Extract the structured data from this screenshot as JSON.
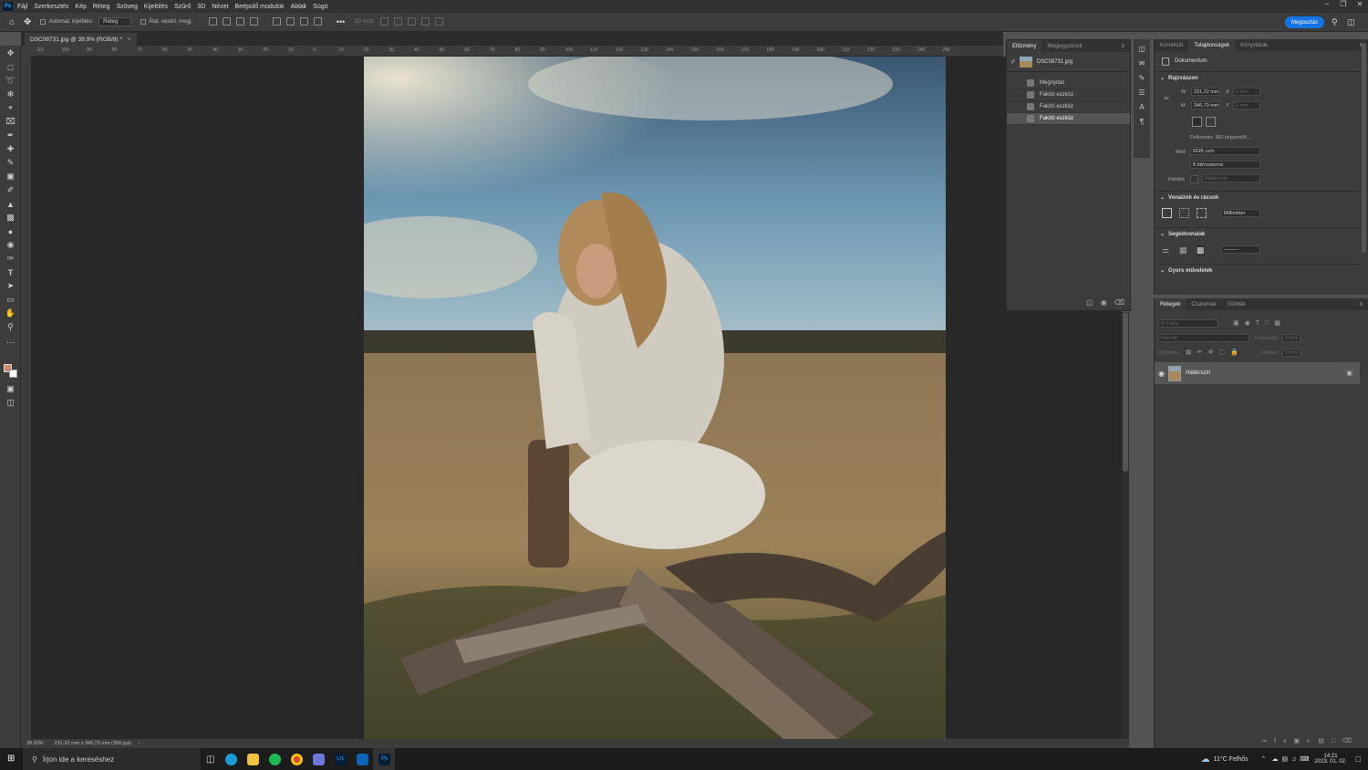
{
  "app": {
    "logo": "Ps"
  },
  "menu": [
    "Fájl",
    "Szerkesztés",
    "Kép",
    "Réteg",
    "Szöveg",
    "Kijelölés",
    "Szűrő",
    "3D",
    "Nézet",
    "Beépülő modulok",
    "Ablak",
    "Súgó"
  ],
  "options": {
    "auto_select_label": "Automat. kijelölés:",
    "auto_select_value": "Réteg",
    "transform_label": "Átal. vezérl. megj.",
    "mode3d": "3D mód:",
    "share": "Megosztás"
  },
  "document": {
    "tab": "DSC08731.jpg @ 39,9% (RGB/8) *",
    "zoom": "39,93%",
    "size_info": "231,22 mm x 346,79 mm (300 ppi)"
  },
  "ruler_ticks": [
    "110",
    "100",
    "90",
    "80",
    "70",
    "60",
    "50",
    "40",
    "30",
    "20",
    "10",
    "0",
    "10",
    "20",
    "30",
    "40",
    "50",
    "60",
    "70",
    "80",
    "90",
    "100",
    "110",
    "120",
    "130",
    "140",
    "150",
    "160",
    "170",
    "180",
    "190",
    "200",
    "210",
    "220",
    "230",
    "240",
    "250"
  ],
  "history": {
    "tabs": [
      "Előzmény",
      "Megjegyzések"
    ],
    "snapshot": "DSC08731.jpg",
    "steps": [
      "Megnyitás",
      "Fakító eszköz",
      "Fakító eszköz",
      "Fakító eszköz"
    ]
  },
  "properties": {
    "tabs": [
      "Korrekció",
      "Tulajdonságok",
      "Könyvtárak"
    ],
    "doc_label": "Dokumentum",
    "canvas_section": "Rajzvászon",
    "w_label": "W",
    "w_value": "231,22 mm",
    "h_label": "M",
    "h_value": "346,79 mm",
    "x_label": "X",
    "x_value": "0 mm",
    "y_label": "Y",
    "y_value": "0 mm",
    "resolution": "Felbontás:  300  képpont/h...",
    "mode_label": "Mód",
    "mode_value": "RGB szín",
    "depth_value": "8 bit/csatorna",
    "fill_label": "Kitöltés",
    "fill_value": "Háttérszín",
    "rulers_section": "Vonalzók és rácsok",
    "units_value": "Milliméter",
    "guides_section": "Segédvonalak",
    "quick_section": "Gyors műveletek"
  },
  "layers": {
    "tabs": [
      "Rétegek",
      "Csatornák",
      "Görbék"
    ],
    "search_placeholder": "Fajta",
    "blend_mode": "Normál",
    "opacity_label": "Fedettség:",
    "opacity_value": "100%",
    "lock_label": "Rögzítés:",
    "fill_label": "Kitöltés:",
    "fill_value": "100%",
    "layer_name": "Háttérszín"
  },
  "taskbar": {
    "search": "Írjon ide a kereséshez",
    "weather": "11°C  Felhős",
    "time": "14:21",
    "date": "2023. 01. 02."
  },
  "colors": {
    "accent": "#1473e6",
    "foreground_swatch": "#c9876a",
    "background_swatch": "#ffffff"
  }
}
